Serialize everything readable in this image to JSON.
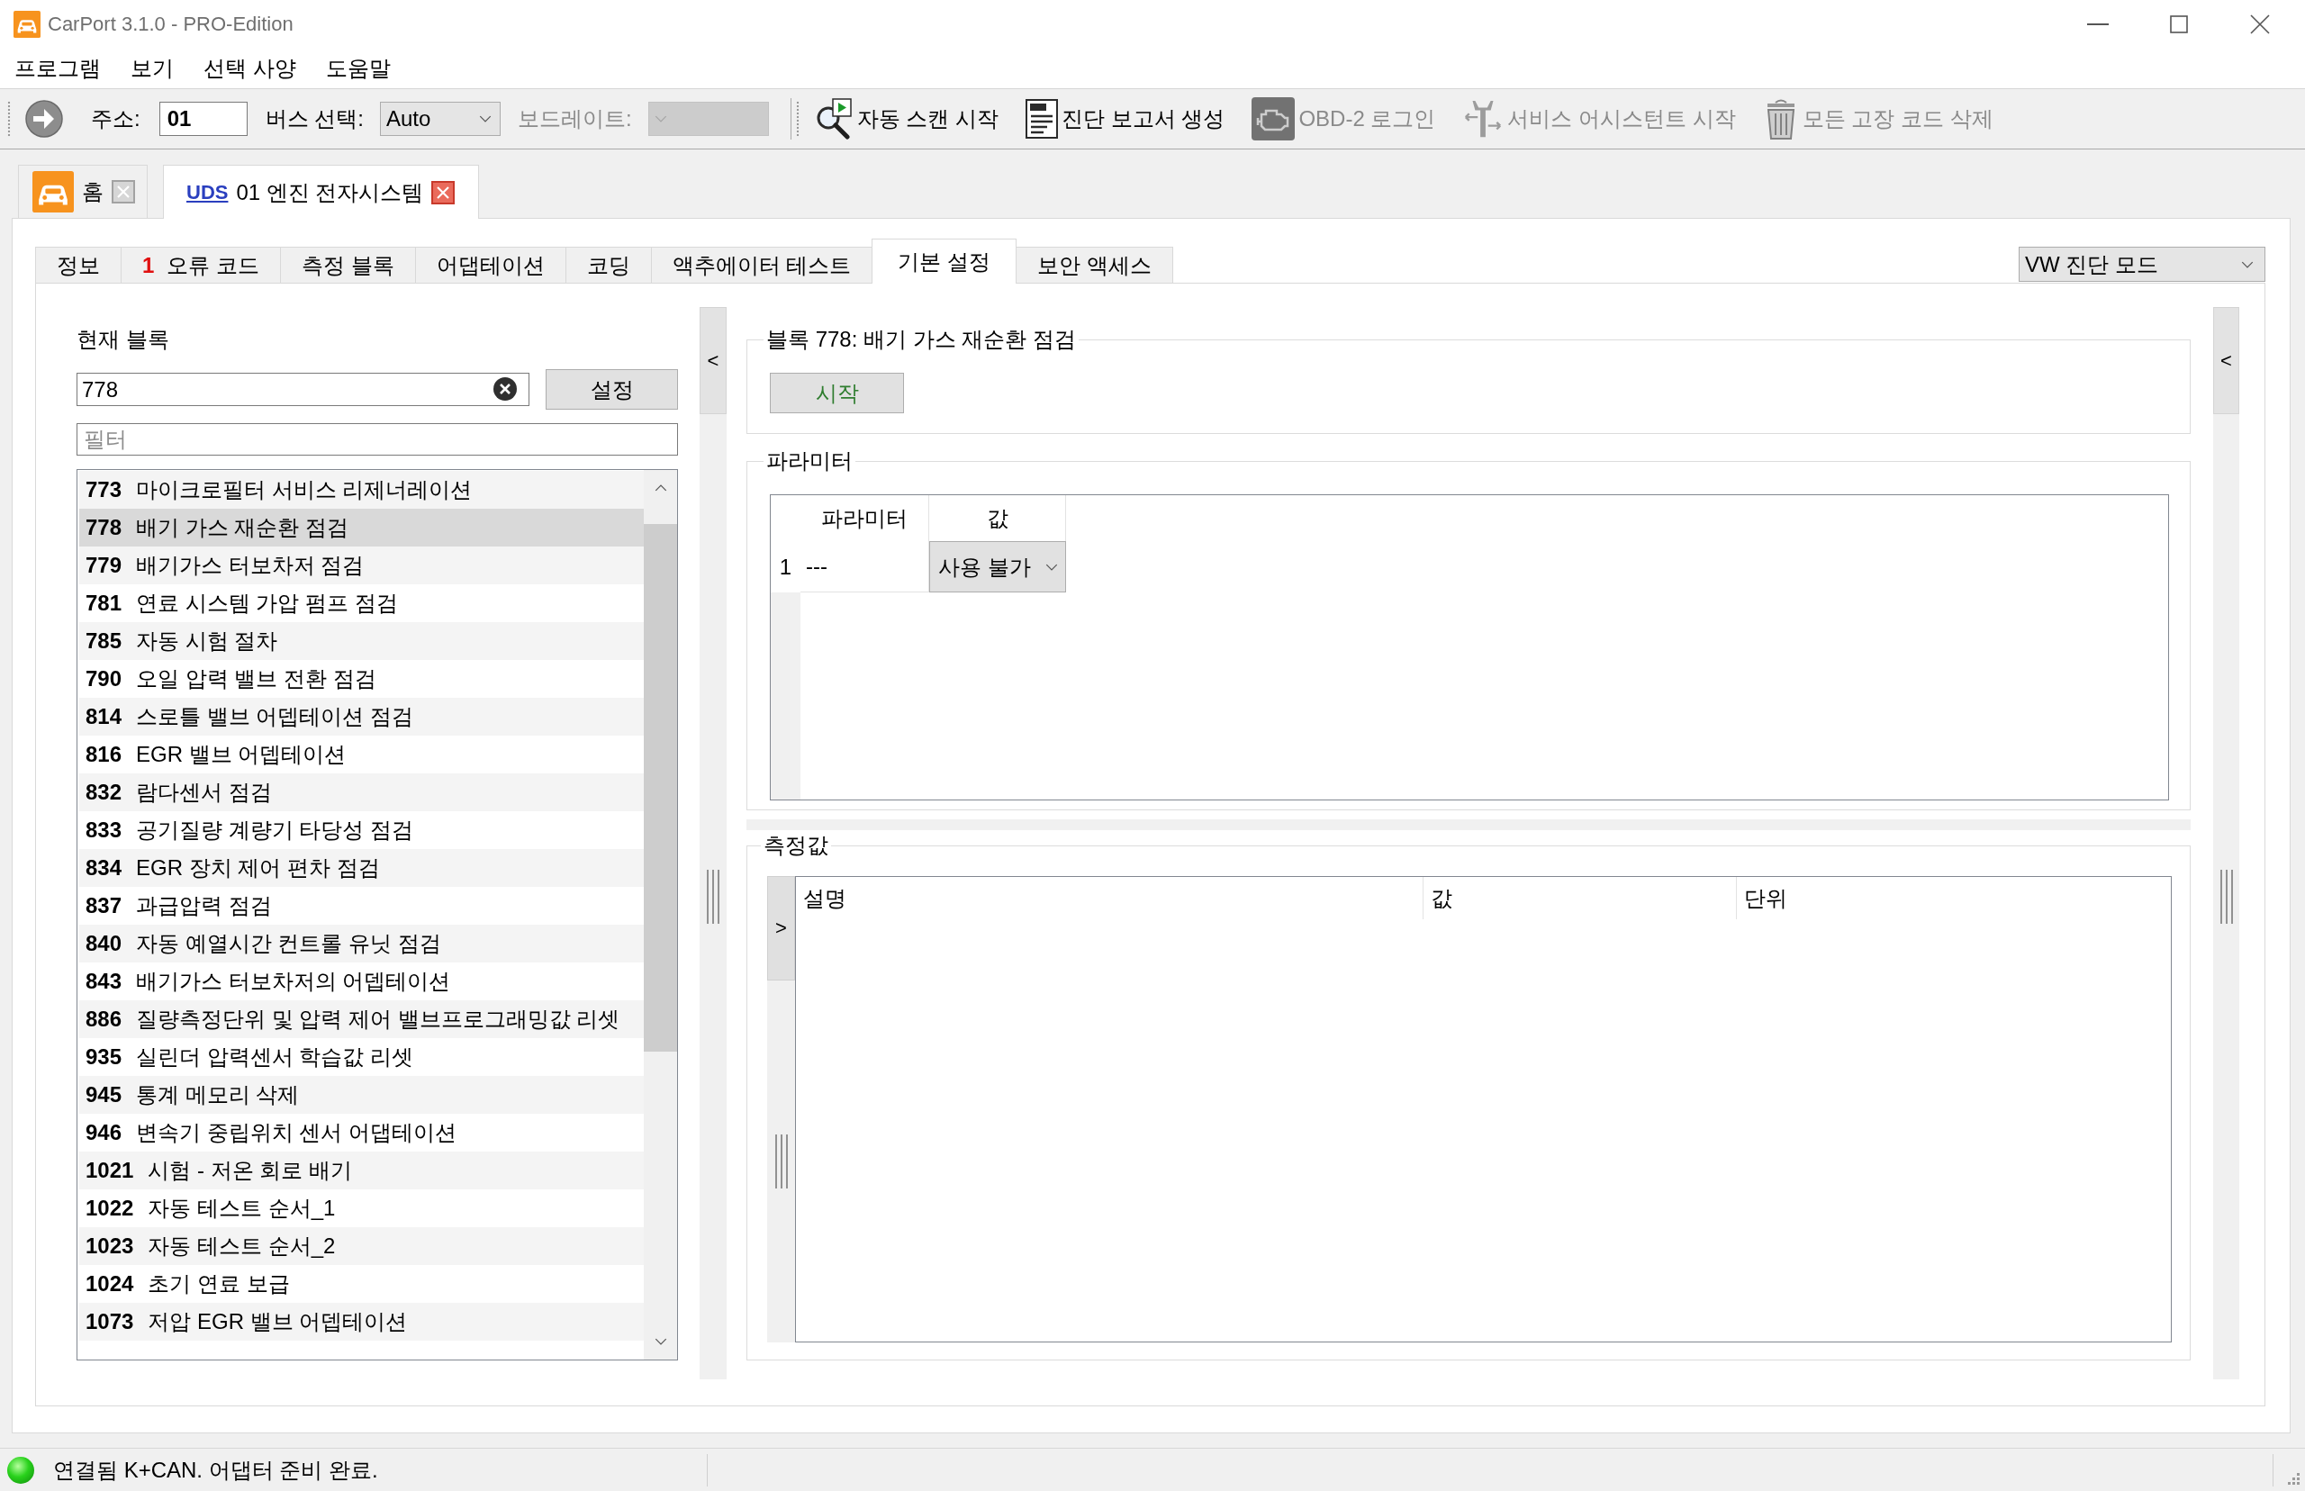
{
  "window": {
    "title": "CarPort 3.1.0 - PRO-Edition"
  },
  "menu": [
    {
      "label": "프로그램"
    },
    {
      "label": "보기"
    },
    {
      "label": "선택 사양"
    },
    {
      "label": "도움말"
    }
  ],
  "toolbar": {
    "address_label": "주소:",
    "address": "01",
    "bus_label": "버스 선택:",
    "bus": "Auto",
    "baud_label": "보드레이트:",
    "baud_disabled": true,
    "actions": [
      {
        "label": "자동 스캔 시작",
        "disabled": false
      },
      {
        "label": "진단 보고서 생성",
        "disabled": false
      },
      {
        "label": "OBD-2 로그인",
        "disabled": true
      },
      {
        "label": "서비스 어시스턴트 시작",
        "disabled": true
      },
      {
        "label": "모든 고장 코드 삭제",
        "disabled": true
      }
    ]
  },
  "document_tabs": [
    {
      "kind": "home",
      "label": "홈",
      "selected": false
    },
    {
      "kind": "module",
      "protocol": "UDS",
      "label": "01 엔진 전자시스템",
      "selected": true
    }
  ],
  "tabs": [
    {
      "label": "정보",
      "selected": false
    },
    {
      "count": "1",
      "label": "오류 코드",
      "selected": false
    },
    {
      "label": "측정 블록",
      "selected": false
    },
    {
      "label": "어댑테이션",
      "selected": false
    },
    {
      "label": "코딩",
      "selected": false
    },
    {
      "label": "액추에이터 테스트",
      "selected": false
    },
    {
      "label": "기본 설정",
      "selected": true
    },
    {
      "label": "보안 액세스",
      "selected": false
    }
  ],
  "mode": "VW 진단 모드",
  "left_splitter": {
    "toggle": "<"
  },
  "block_panel": {
    "label": "현재 블록",
    "value": "778",
    "set_button": "설정",
    "filter_placeholder": "필터",
    "items": [
      {
        "code": "773",
        "name": "마이크로필터 서비스 리제너레이션",
        "selected": false
      },
      {
        "code": "778",
        "name": "배기 가스 재순환 점검",
        "selected": true
      },
      {
        "code": "779",
        "name": "배기가스 터보차저 점검",
        "selected": false
      },
      {
        "code": "781",
        "name": "연료 시스템 가압 펌프 점검",
        "selected": false
      },
      {
        "code": "785",
        "name": "자동 시험 절차",
        "selected": false
      },
      {
        "code": "790",
        "name": "오일 압력 밸브 전환 점검",
        "selected": false
      },
      {
        "code": "814",
        "name": "스로틀 밸브 어뎁테이션 점검",
        "selected": false
      },
      {
        "code": "816",
        "name": "EGR 밸브 어뎁테이션",
        "selected": false
      },
      {
        "code": "832",
        "name": "람다센서 점검",
        "selected": false
      },
      {
        "code": "833",
        "name": "공기질량 계량기 타당성 점검",
        "selected": false
      },
      {
        "code": "834",
        "name": "EGR 장치 제어 편차 점검",
        "selected": false
      },
      {
        "code": "837",
        "name": "과급압력 점검",
        "selected": false
      },
      {
        "code": "840",
        "name": "자동 예열시간 컨트롤 유닛 점검",
        "selected": false
      },
      {
        "code": "843",
        "name": "배기가스 터보차저의 어뎁테이션",
        "selected": false
      },
      {
        "code": "886",
        "name": "질량측정단위 및 압력 제어 밸브프로그래밍값 리셋",
        "selected": false
      },
      {
        "code": "935",
        "name": "실린더 압력센서 학습값 리셋",
        "selected": false
      },
      {
        "code": "945",
        "name": "통계 메모리 삭제",
        "selected": false
      },
      {
        "code": "946",
        "name": "변속기 중립위치 센서 어댑테이션",
        "selected": false
      },
      {
        "code": "1021",
        "name": "시험 - 저온 회로 배기",
        "selected": false
      },
      {
        "code": "1022",
        "name": "자동 테스트 순서_1",
        "selected": false
      },
      {
        "code": "1023",
        "name": "자동 테스트 순서_2",
        "selected": false
      },
      {
        "code": "1024",
        "name": "초기 연료 보급",
        "selected": false
      },
      {
        "code": "1073",
        "name": "저압 EGR 밸브 어뎁테이션",
        "selected": false
      }
    ]
  },
  "block_group": {
    "title": "블록 778: 배기 가스 재순환 점검",
    "start_button": "시작"
  },
  "parameters": {
    "title": "파라미터",
    "columns": [
      "파라미터",
      "값"
    ],
    "rows": [
      {
        "number": "1",
        "name": "---",
        "value": "사용 불가"
      }
    ]
  },
  "measurements": {
    "title": "측정값",
    "toggle": ">",
    "columns": [
      "설명",
      "값",
      "단위"
    ]
  },
  "right_splitter": {
    "toggle": "<"
  },
  "status_bar": {
    "connected": true,
    "text": "연결됨 K+CAN. 어댑터 준비 완료."
  }
}
